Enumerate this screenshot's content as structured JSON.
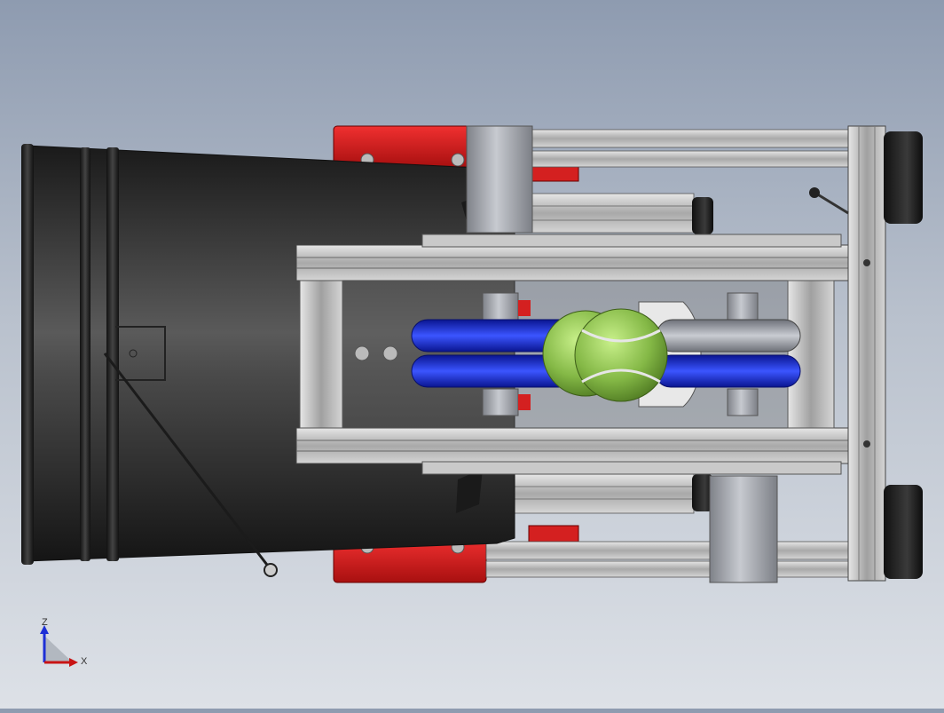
{
  "viewport": {
    "model_name": "tennis-ball-launcher-assembly",
    "view": "top",
    "colors": {
      "background_top": "#8e9bb0",
      "background_bottom": "#dde1e7",
      "barrel": "#3a3a3a",
      "frame": "#b8b8b8",
      "red_mount": "#d42020",
      "blue_tube": "#1024c8",
      "ball": "#8ec04a",
      "motor": "#a3a6ad"
    }
  },
  "triad": {
    "z_label": "Z",
    "x_label": "X"
  }
}
